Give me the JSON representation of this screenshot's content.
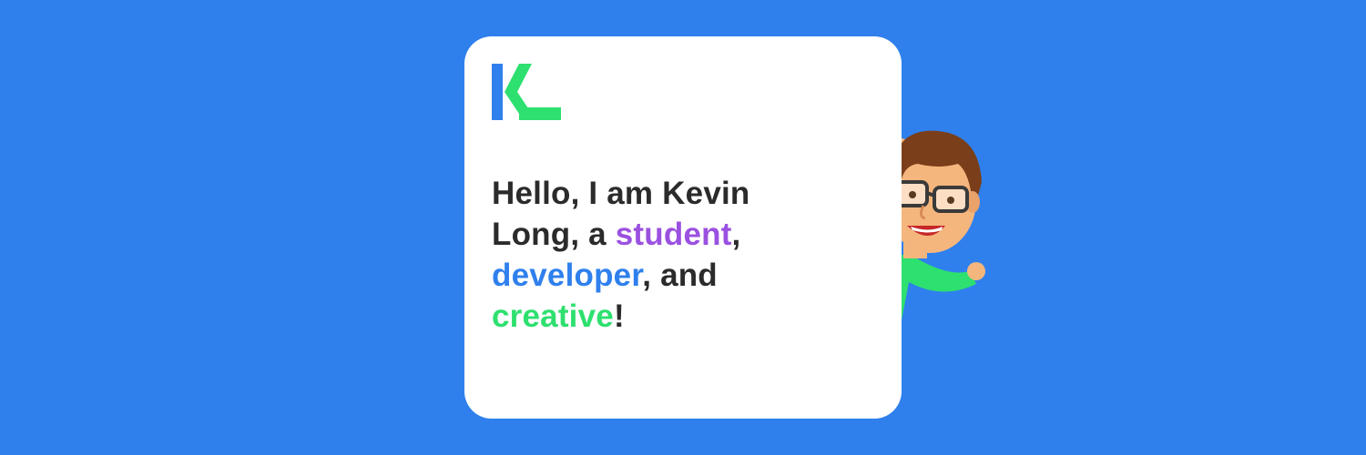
{
  "banner": {
    "background_color": "#2f80ed"
  },
  "logo": {
    "text": "KL",
    "colors": {
      "k": "#2f80ed",
      "l": "#2ee06f"
    }
  },
  "greeting": {
    "line1": "Hello, I am Kevin",
    "line2_prefix": "Long, a ",
    "word_student": "student",
    "line2_suffix": ",",
    "word_developer": "developer",
    "line3_suffix": ", and",
    "word_creative": "creative",
    "line4_suffix": "!",
    "colors": {
      "text": "#2b2b2b",
      "student": "#9b51e0",
      "developer": "#2f80ed",
      "creative": "#2ee06f"
    }
  },
  "illustration": {
    "icon": "peeking-developer-with-glasses"
  }
}
